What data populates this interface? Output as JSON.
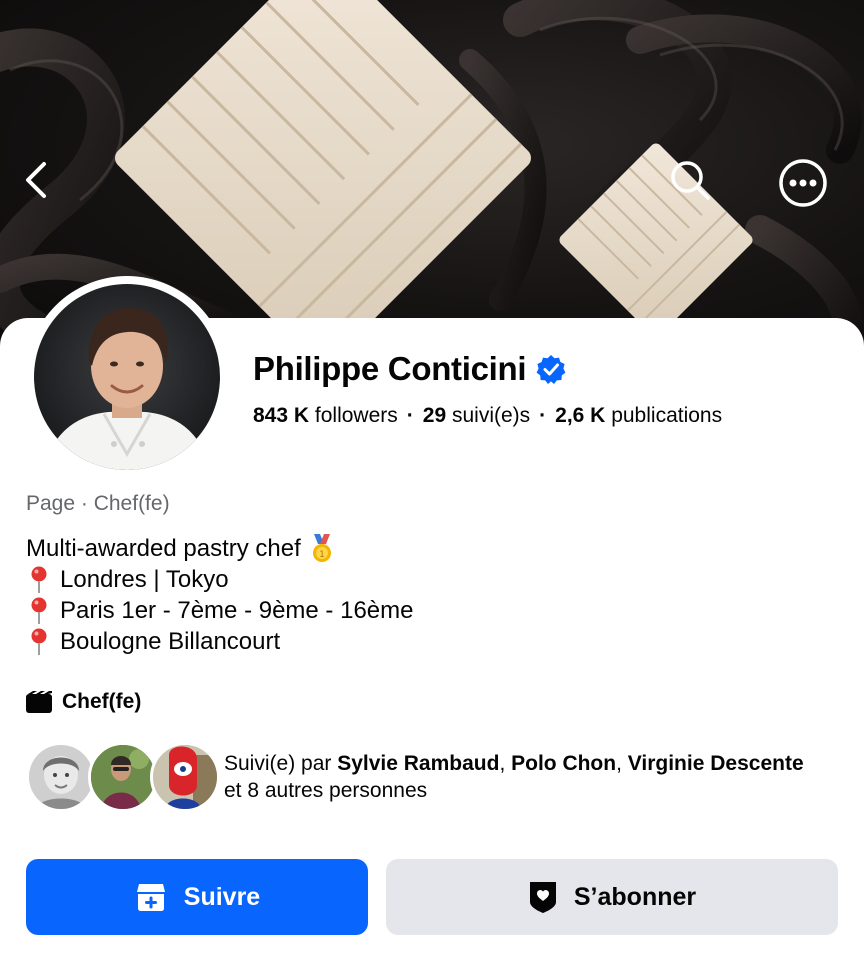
{
  "profile": {
    "name": "Philippe Conticini",
    "verified": true,
    "stats": {
      "followers_value": "843 K",
      "followers_label": "followers",
      "following_value": "29",
      "following_label": "suivi(e)s",
      "posts_value": "2,6 K",
      "posts_label": "publications",
      "separator": "·"
    },
    "category_line": "Page · Chef(fe)",
    "bio": [
      {
        "icon": "medal-icon",
        "text": "Multi-awarded pastry chef"
      },
      {
        "icon": "pin-icon",
        "text": "Londres | Tokyo"
      },
      {
        "icon": "pin-icon",
        "text": "Paris 1er - 7ème - 9ème - 16ème"
      },
      {
        "icon": "pin-icon",
        "text": "Boulogne Billancourt"
      }
    ],
    "intro_category": {
      "icon": "clapper-icon",
      "label": "Chef(fe)"
    }
  },
  "followed_by": {
    "prefix": "Suivi(e) par ",
    "names": [
      "Sylvie Rambaud",
      "Polo Chon",
      "Virginie Descente"
    ],
    "separator": ", ",
    "suffix": "et 8 autres personnes"
  },
  "actions": {
    "follow_label": "Suivre",
    "subscribe_label": "S’abonner"
  },
  "icons": {
    "back": "chevron-left-icon",
    "search": "search-icon",
    "more": "more-icon",
    "verified": "verified-badge-icon",
    "follow": "follow-page-icon",
    "subscribe": "subscribe-shield-icon"
  },
  "colors": {
    "accent": "#0866ff",
    "secondary_button": "#e4e6eb",
    "muted_text": "#65676b",
    "text": "#050505"
  }
}
